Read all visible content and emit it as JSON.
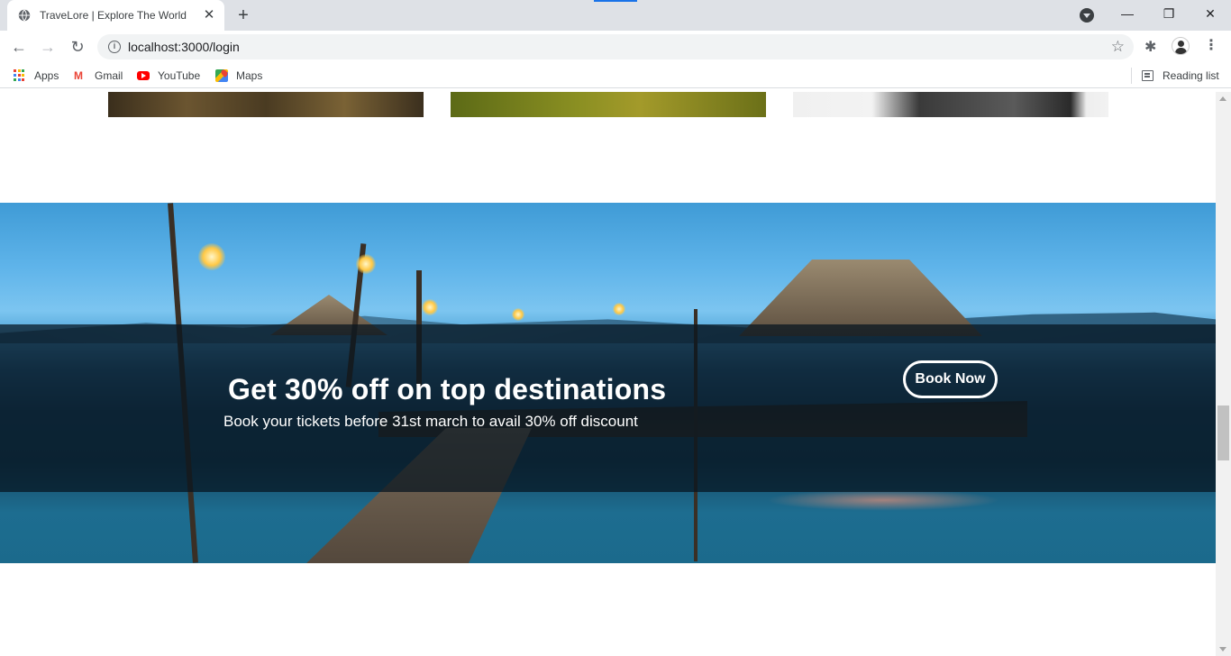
{
  "browser": {
    "tab_title": "TraveLore | Explore The World",
    "url": "localhost:3000/login",
    "bookmarks": [
      {
        "label": "Apps",
        "icon": "apps-grid-icon"
      },
      {
        "label": "Gmail",
        "icon": "gmail-icon"
      },
      {
        "label": "YouTube",
        "icon": "youtube-icon"
      },
      {
        "label": "Maps",
        "icon": "maps-icon"
      }
    ],
    "reading_list_label": "Reading list"
  },
  "promo": {
    "title": "Get 30% off on top destinations",
    "subtitle": "Book your tickets before 31st march to avail 30% off discount",
    "cta_label": "Book Now"
  },
  "colors": {
    "tabstrip_bg": "#dee1e6",
    "overlay": "rgba(5, 20, 30, 0.72)",
    "text_on_banner": "#ffffff"
  }
}
